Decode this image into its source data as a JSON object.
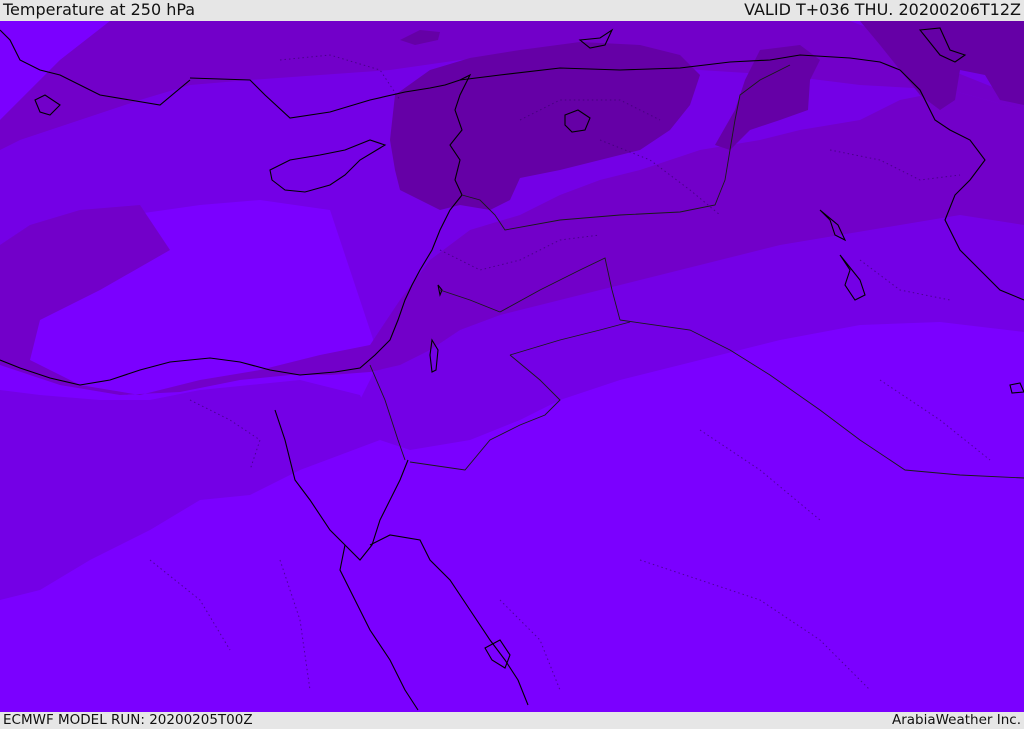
{
  "header": {
    "title": "Temperature at 250 hPa",
    "valid": "VALID T+036 THU. 20200206T12Z"
  },
  "footer": {
    "model_run": "ECMWF MODEL RUN: 20200205T00Z",
    "credit": "ArabiaWeather Inc."
  },
  "colors": {
    "band_warmest": "#7b00ff",
    "band_warm": "#7400e6",
    "band_mid": "#7200c9",
    "band_cold": "#6500a6",
    "coastline": "#000000",
    "border": "#1a1a1a"
  }
}
